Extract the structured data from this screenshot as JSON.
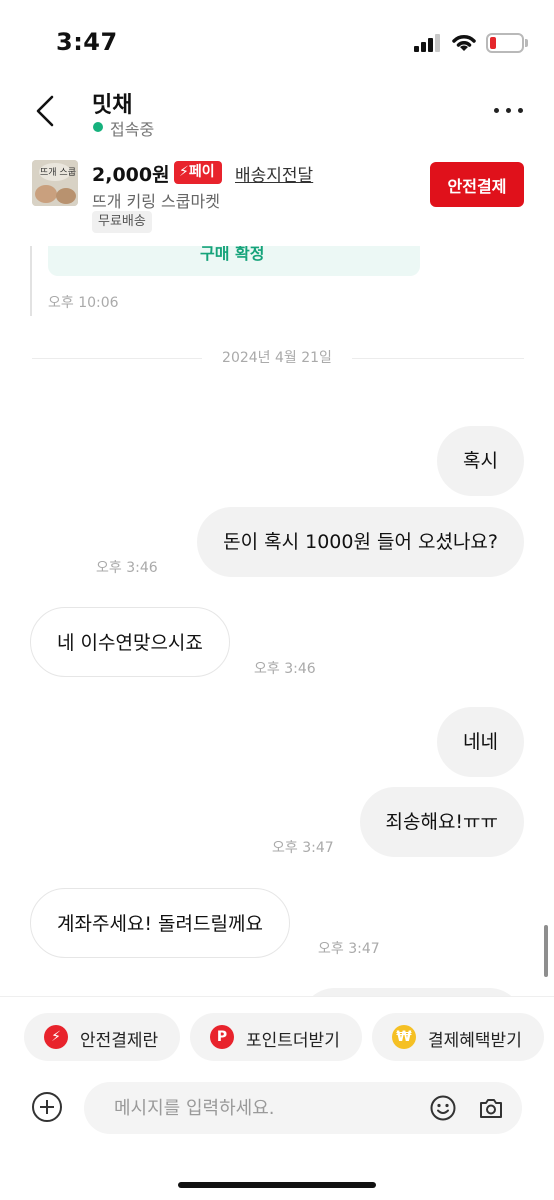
{
  "status_bar": {
    "time": "3:47"
  },
  "header": {
    "chat_name": "밋채",
    "status": "접속중"
  },
  "product": {
    "thumbnail_text": "뜨개 스쿱",
    "price": "2,000원",
    "pay_badge": "페이",
    "shipping_method": "배송지전달",
    "title": "뜨개 키링 스쿱마켓",
    "free_shipping": "무료배송",
    "safe_pay_button": "안전결제"
  },
  "previous": {
    "card_text": "구매 확정",
    "time": "오후 10:06"
  },
  "date_divider": "2024년 4월 21일",
  "messages": [
    {
      "from": "me",
      "text": "혹시"
    },
    {
      "from": "me",
      "text": "돈이 혹시 1000원 들어 오셨나요?",
      "time": "오후 3:46"
    },
    {
      "from": "them",
      "text": "네 이수연맞으시죠",
      "time": "오후 3:46"
    },
    {
      "from": "me",
      "text": "네네"
    },
    {
      "from": "me",
      "text": "죄송해요!ㅠㅠ",
      "time": "오후 3:47"
    },
    {
      "from": "them",
      "text": "계좌주세요! 돌려드릴께요",
      "time": "오후 3:47"
    }
  ],
  "quick_actions": [
    {
      "label": "안전결제란",
      "icon": "lightning-icon",
      "color": "#e8232c"
    },
    {
      "label": "포인트더받기",
      "icon": "p-icon",
      "color": "#e8232c"
    },
    {
      "label": "결제혜택받기",
      "icon": "won-icon",
      "color": "#f5c024"
    }
  ],
  "input": {
    "placeholder": "메시지를 입력하세요."
  }
}
